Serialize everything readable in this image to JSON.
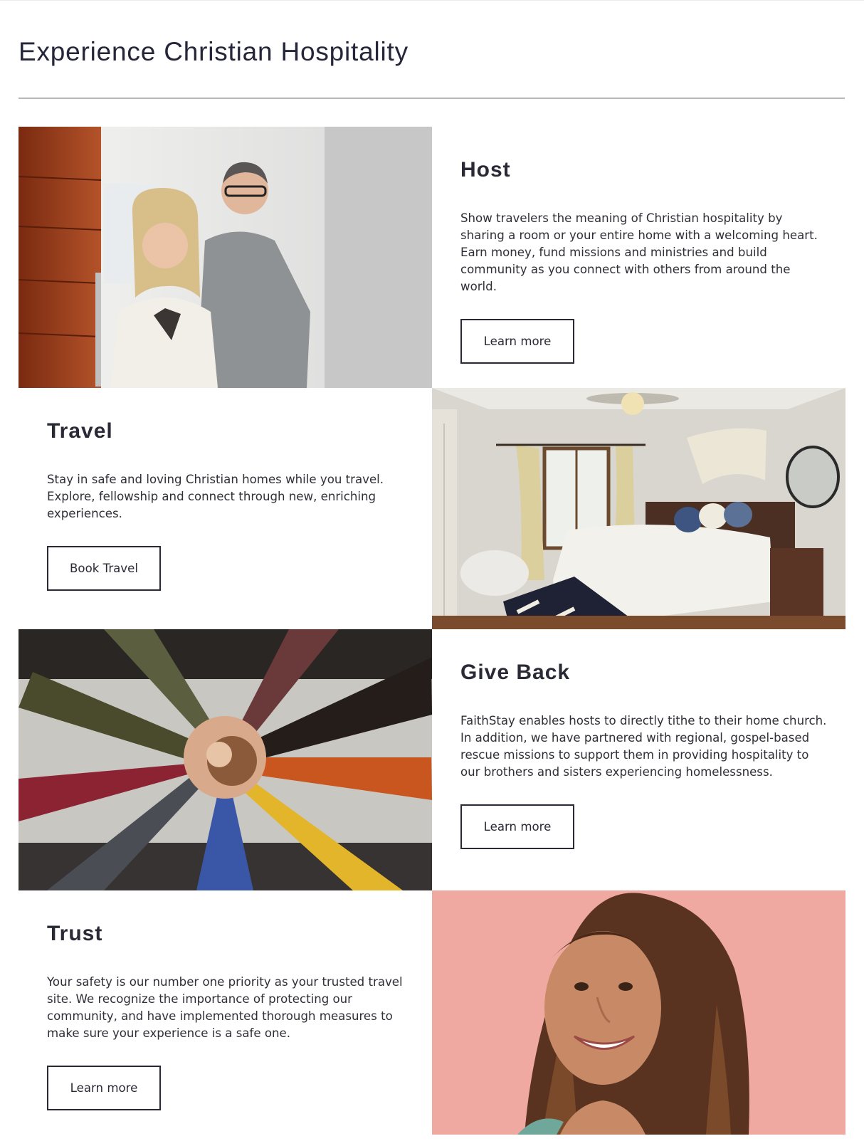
{
  "page": {
    "title": "Experience Christian Hospitality"
  },
  "sections": [
    {
      "heading": "Host",
      "body": "Show travelers the meaning of Christian hospitality by sharing a room or your entire home with a welcoming heart. Earn money, fund missions and ministries and build community as you connect with others from around the world.",
      "button_label": "Learn more",
      "image_icon": "couple-at-front-door-photo"
    },
    {
      "heading": "Travel",
      "body": "Stay in safe and loving Christian homes while you travel. Explore, fellowship and connect through new, enriching experiences.",
      "button_label": "Book Travel",
      "image_icon": "guest-bedroom-photo"
    },
    {
      "heading": "Give Back",
      "body": "FaithStay enables hosts to directly tithe to their home church. In addition, we have partnered with regional, gospel-based rescue missions to support them in providing hospitality to our brothers and sisters experiencing homelessness.",
      "button_label": "Learn more",
      "image_icon": "hands-together-circle-photo"
    },
    {
      "heading": "Trust",
      "body": "Your safety is our number one priority as your trusted travel site. We recognize the importance of protecting our community, and have implemented thorough measures to make sure your experience is a safe one.",
      "button_label": "Learn more",
      "image_icon": "smiling-woman-portrait-photo"
    }
  ],
  "colors": {
    "text": "#2a2a36",
    "divider": "#b8b8b8",
    "portrait_background": "#f0a9a0"
  }
}
